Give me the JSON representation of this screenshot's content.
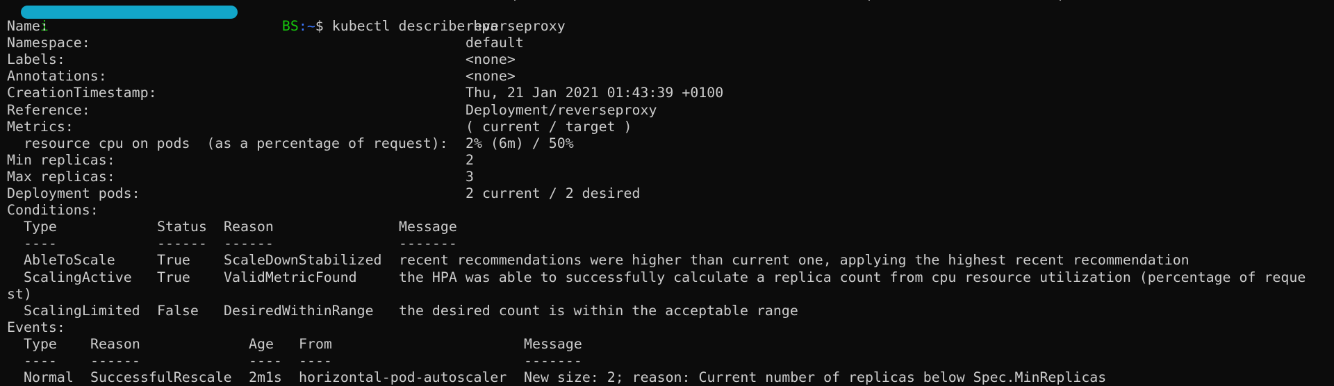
{
  "window": {
    "background": "#0c0c0c",
    "foreground": "#cccccc",
    "prompt_user_color": "#16c60c",
    "prompt_path_color": "#3b78ff",
    "redaction_color": "#12a6c9"
  },
  "prompt": {
    "user_host_visible": "i",
    "user_host_tail": "BS",
    "path": ":~",
    "symbol": "$",
    "command": " kubectl describe hpa"
  },
  "fields": [
    {
      "key": "Name:",
      "value": "reverseproxy"
    },
    {
      "key": "Namespace:",
      "value": "default"
    },
    {
      "key": "Labels:",
      "value": "<none>"
    },
    {
      "key": "Annotations:",
      "value": "<none>"
    },
    {
      "key": "CreationTimestamp:",
      "value": "Thu, 21 Jan 2021 01:43:39 +0100"
    },
    {
      "key": "Reference:",
      "value": "Deployment/reverseproxy"
    },
    {
      "key": "Metrics:",
      "value": "( current / target )"
    },
    {
      "key": "  resource cpu on pods  (as a percentage of request):",
      "value": "2% (6m) / 50%"
    },
    {
      "key": "Min replicas:",
      "value": "2"
    },
    {
      "key": "Max replicas:",
      "value": "3"
    },
    {
      "key": "Deployment pods:",
      "value": "2 current / 2 desired"
    }
  ],
  "conditions": {
    "title": "Conditions:",
    "headers": [
      "Type",
      "Status",
      "Reason",
      "Message"
    ],
    "underlines": [
      "----",
      "------",
      "------",
      "-------"
    ],
    "rows": [
      [
        "AbleToScale",
        "True",
        "ScaleDownStabilized",
        "recent recommendations were higher than current one, applying the highest recent recommendation"
      ],
      [
        "ScalingActive",
        "True",
        "ValidMetricFound",
        "the HPA was able to successfully calculate a replica count from cpu resource utilization (percentage of reque"
      ],
      [
        "ScalingLimited",
        "False",
        "DesiredWithinRange",
        "the desired count is within the acceptable range"
      ]
    ],
    "wrap_continuation": "st)"
  },
  "events": {
    "title": "Events:",
    "headers": [
      "Type",
      "Reason",
      "Age",
      "From",
      "Message"
    ],
    "underlines": [
      "----",
      "------",
      "----",
      "----",
      "-------"
    ],
    "rows": [
      [
        "Normal",
        "SuccessfulRescale",
        "2m1s",
        "horizontal-pod-autoscaler",
        "New size: 2; reason: Current number of replicas below Spec.MinReplicas"
      ]
    ]
  }
}
